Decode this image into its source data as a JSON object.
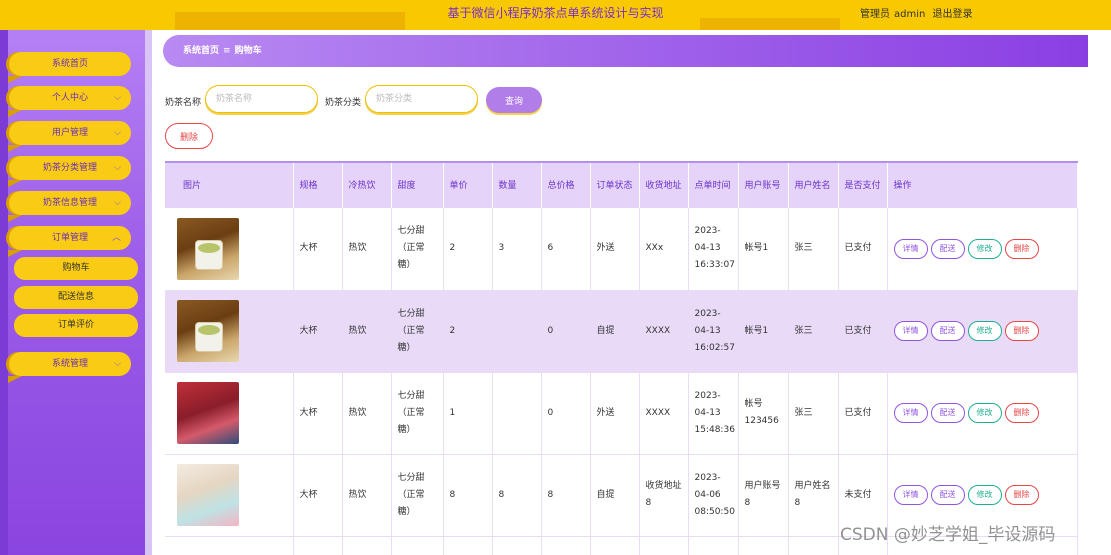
{
  "header": {
    "title": "基于微信小程序奶茶点单系统设计与实现",
    "user_role": "管理员",
    "username": "admin",
    "logout": "退出登录"
  },
  "sidebar": {
    "items": [
      {
        "label": "系统首页",
        "has_chevron": false
      },
      {
        "label": "个人中心",
        "has_chevron": true
      },
      {
        "label": "用户管理",
        "has_chevron": true
      },
      {
        "label": "奶茶分类管理",
        "has_chevron": true
      },
      {
        "label": "奶茶信息管理",
        "has_chevron": true
      },
      {
        "label": "订单管理",
        "has_chevron": true,
        "expanded": true
      },
      {
        "label": "系统管理",
        "has_chevron": true
      }
    ],
    "sub_items": [
      {
        "label": "购物车"
      },
      {
        "label": "配送信息"
      },
      {
        "label": "订单评价"
      }
    ]
  },
  "breadcrumb": {
    "home": "系统首页",
    "separator": "≡",
    "current": "购物车"
  },
  "search": {
    "name_label": "奶茶名称",
    "name_placeholder": "奶茶名称",
    "category_label": "奶茶分类",
    "category_placeholder": "奶茶分类",
    "search_button": "查询"
  },
  "actions": {
    "delete_button": "删除"
  },
  "table": {
    "headers": [
      "图片",
      "规格",
      "冷热饮",
      "甜度",
      "单价",
      "数量",
      "总价格",
      "订单状态",
      "收货地址",
      "点单时间",
      "用户账号",
      "用户姓名",
      "是否支付",
      "操作"
    ],
    "operations": {
      "detail": "详情",
      "ship": "配送",
      "edit": "修改",
      "delete": "删除"
    },
    "rows": [
      {
        "spec": "大杯",
        "temp": "热饮",
        "sweetness": "七分甜（正常糖）",
        "price": "2",
        "qty": "3",
        "total": "6",
        "status": "外送",
        "address": "XXx",
        "time": "2023-04-13 16:33:07",
        "account": "帐号1",
        "name": "张三",
        "paid": "已支付"
      },
      {
        "spec": "大杯",
        "temp": "热饮",
        "sweetness": "七分甜（正常糖）",
        "price": "2",
        "qty": "",
        "total": "0",
        "status": "自提",
        "address": "XXXX",
        "time": "2023-04-13 16:02:57",
        "account": "帐号1",
        "name": "张三",
        "paid": "已支付"
      },
      {
        "spec": "大杯",
        "temp": "热饮",
        "sweetness": "七分甜（正常糖）",
        "price": "1",
        "qty": "",
        "total": "0",
        "status": "外送",
        "address": "XXXX",
        "time": "2023-04-13 15:48:36",
        "account": "帐号123456",
        "name": "张三",
        "paid": "已支付"
      },
      {
        "spec": "大杯",
        "temp": "热饮",
        "sweetness": "七分甜（正常糖）",
        "price": "8",
        "qty": "8",
        "total": "8",
        "status": "自提",
        "address": "收货地址8",
        "time": "2023-04-06 08:50:50",
        "account": "用户账号8",
        "name": "用户姓名8",
        "paid": "未支付"
      }
    ]
  },
  "watermark": "CSDN @妙芝学姐_毕设源码",
  "colors": {
    "topbar": "#f8c900",
    "sidebar": "#9c5ce8",
    "accent_purple": "#8a3fe3",
    "row_alt": "#e9dbf8"
  }
}
